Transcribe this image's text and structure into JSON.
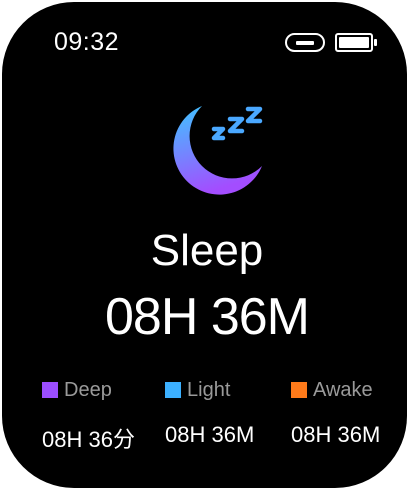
{
  "status_bar": {
    "time": "09:32"
  },
  "screen": {
    "icon": "sleep-moon-zzz-icon",
    "title": "Sleep",
    "total_duration": "08H 36M"
  },
  "legend": [
    {
      "label": "Deep",
      "color": "#9b4dff",
      "duration": "08H 36分"
    },
    {
      "label": "Light",
      "color": "#3cb0ff",
      "duration": "08H 36M"
    },
    {
      "label": "Awake",
      "color": "#ff7a1a",
      "duration": "08H 36M"
    }
  ],
  "colors": {
    "background": "#000000",
    "moon_gradient_top": "#3ec5ff",
    "moon_gradient_bottom": "#a34dff",
    "zzz": "#4aa8ff"
  }
}
